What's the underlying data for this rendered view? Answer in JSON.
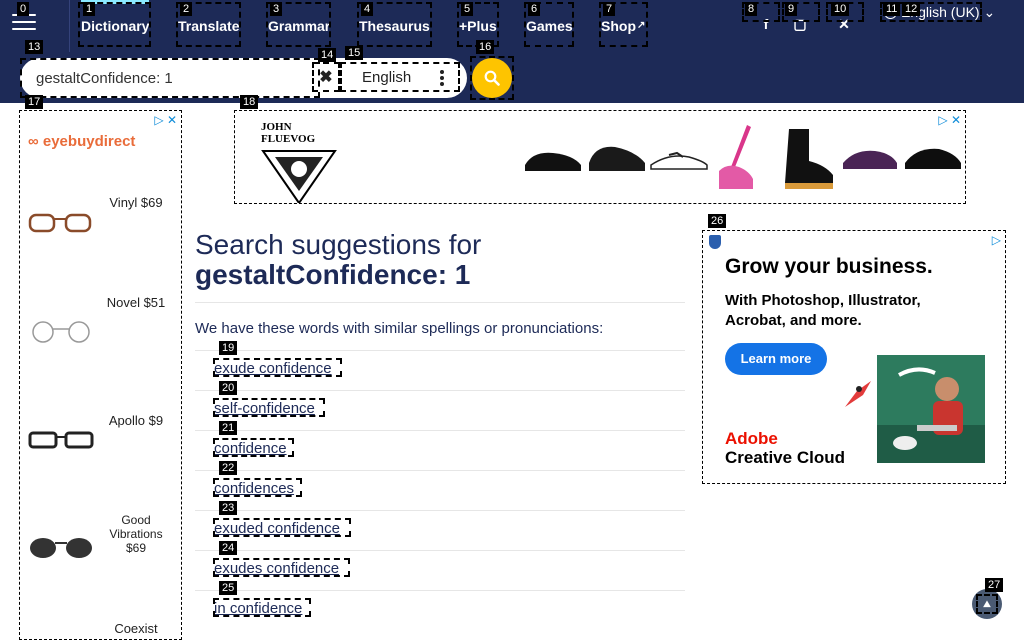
{
  "nav": {
    "menu_icon": "hamburger-icon",
    "items": [
      {
        "label": "Dictionary"
      },
      {
        "label": "Translate"
      },
      {
        "label": "Grammar"
      },
      {
        "label": "Thesaurus"
      },
      {
        "label": "+Plus"
      },
      {
        "label": "Games"
      },
      {
        "label": "Shop",
        "icon": "external-link-icon"
      }
    ],
    "social_icons": [
      "facebook-icon",
      "instagram-icon",
      "twitter-x-icon"
    ],
    "language": "English (UK)"
  },
  "search": {
    "value": "gestaltConfidence: 1",
    "clear_icon": "close-icon",
    "dictionary": "English",
    "button_icon": "search-icon"
  },
  "ads": {
    "left": {
      "brand": "eyebuydirect",
      "products": [
        {
          "label": "Vinyl $69"
        },
        {
          "label": "Novel $51"
        },
        {
          "label": "Apollo $9"
        },
        {
          "label": "Good Vibrations $69"
        },
        {
          "label": "Coexist"
        }
      ]
    },
    "top": {
      "brand": "JOHN FLUEVOG"
    },
    "right": {
      "headline": "Grow your business.",
      "text": "With Photoshop, Illustrator, Acrobat, and more.",
      "button": "Learn more",
      "brand_line1": "Adobe",
      "brand_line2": "Creative Cloud"
    }
  },
  "content": {
    "heading": "Search suggestions for",
    "query": "gestaltConfidence: 1",
    "intro": "We have these words with similar spellings or pronunciations:",
    "suggestions": [
      "exude confidence",
      "self-confidence",
      "confidence",
      "confidences",
      "exuded confidence",
      "exudes confidence",
      "in confidence"
    ]
  },
  "scroll_top_icon": "chevron-up-icon",
  "colors": {
    "header": "#1d2a57",
    "accent": "#fec400",
    "active_tab": "#8ae8ff",
    "ad_blue": "#1473e6"
  },
  "marks": [
    "0",
    "1",
    "2",
    "3",
    "4",
    "5",
    "6",
    "7",
    "8",
    "9",
    "10",
    "11",
    "12",
    "13",
    "14",
    "15",
    "16",
    "17",
    "18",
    "19",
    "20",
    "21",
    "22",
    "23",
    "24",
    "25",
    "26",
    "27"
  ]
}
